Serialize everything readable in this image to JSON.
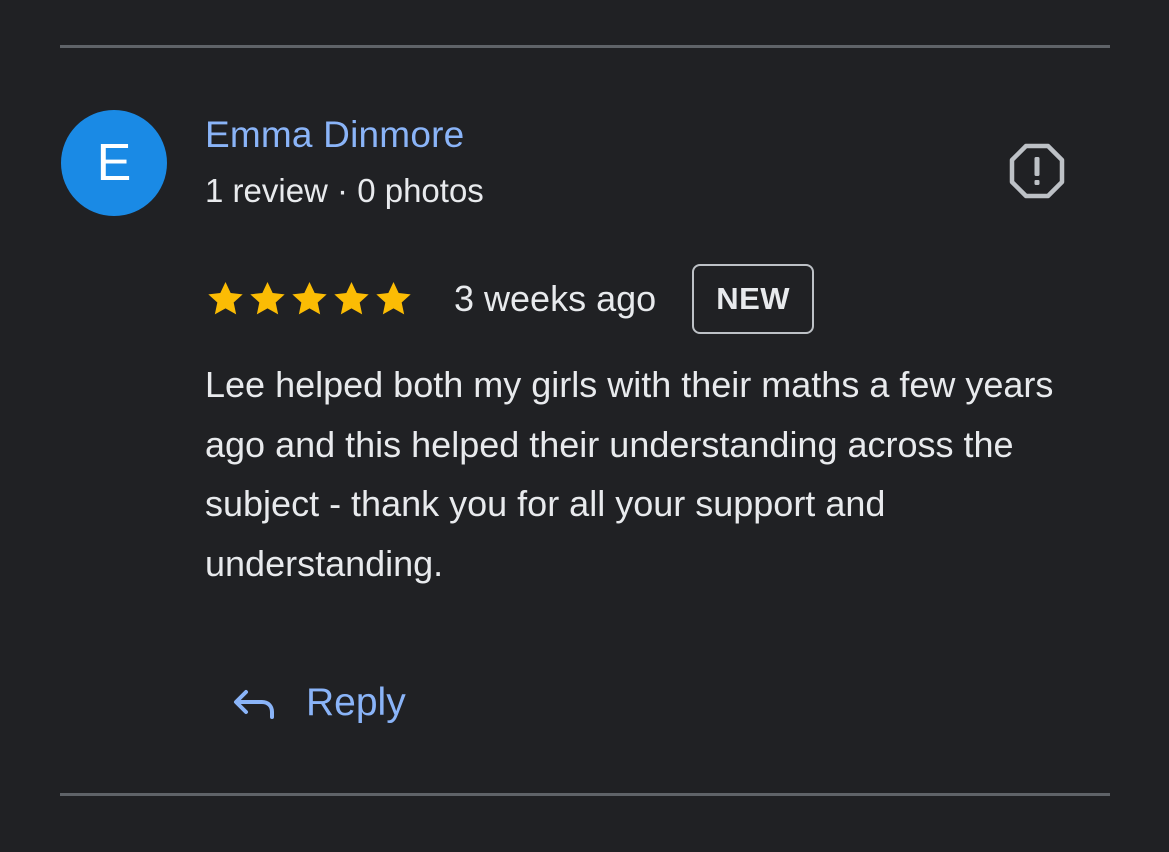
{
  "review": {
    "reviewer": {
      "initial": "E",
      "name": "Emma Dinmore",
      "meta": "1 review · 0 photos"
    },
    "rating": {
      "stars": 5,
      "max_stars": 5
    },
    "time_ago": "3 weeks ago",
    "badge": "NEW",
    "text": "Lee helped both my girls with their maths a few years ago and this helped their understanding across the subject - thank you for all your support and understanding.",
    "actions": {
      "reply_label": "Reply"
    }
  },
  "icons": {
    "report": "report-octagon-icon",
    "star": "star-icon",
    "reply": "reply-arrow-icon"
  },
  "colors": {
    "background": "#202124",
    "accent_blue": "#8ab4f8",
    "avatar_bg": "#1a8ae5",
    "star": "#fbbc04",
    "text": "#e8eaed",
    "divider": "#5f6368"
  }
}
